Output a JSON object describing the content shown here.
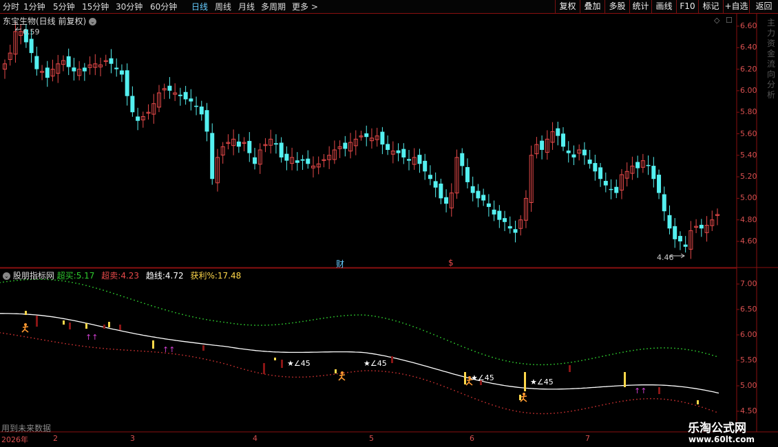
{
  "toolbar": {
    "periods": [
      "分时",
      "1分钟",
      "5分钟",
      "15分钟",
      "30分钟",
      "60分钟",
      "日线",
      "周线",
      "月线",
      "多周期",
      "更多 >"
    ],
    "active_period": "日线",
    "right_buttons": [
      "复权",
      "叠加",
      "多股",
      "统计",
      "画线",
      "F10",
      "标记",
      "+自选",
      "返回"
    ]
  },
  "main_chart": {
    "title": "东宝生物(日线 前复权)",
    "high_label": "6.59",
    "low_label": "4.46",
    "cai_marker": "财",
    "dollar_marker": "$",
    "y_ticks": [
      "6.60",
      "6.40",
      "6.20",
      "6.00",
      "5.80",
      "5.60",
      "5.40",
      "5.20",
      "5.00",
      "4.80",
      "4.60"
    ],
    "side_text": "主力 资金 流向 分析"
  },
  "indicator": {
    "name": "股朋指标网",
    "chaomai_label": "超买:",
    "chaomai_value": "5.17",
    "chaomai2_label": "超卖:",
    "chaomai2_value": "4.23",
    "trend_label": "趋线:",
    "trend_value": "4.72",
    "profit_label": "获利%:",
    "profit_value": "17.48",
    "y_ticks": [
      "7.00",
      "6.50",
      "6.00",
      "5.50",
      "5.00",
      "4.50"
    ],
    "star_labels": [
      "★∠45",
      "★∠45",
      "★∠45",
      "★∠45"
    ],
    "arrow_glyph": "↑↑",
    "footer_note": "用到未来数据"
  },
  "date_axis": {
    "labels": [
      "2026年",
      "2",
      "3",
      "4",
      "5",
      "6",
      "7"
    ]
  },
  "watermark": {
    "name": "乐淘公式网",
    "url": "www.60lt.com"
  },
  "colors": {
    "up": "#e84a4a",
    "down": "#54f0f0",
    "grid": "#8a1010",
    "trend_line": "#ffffff",
    "overbought": "#2ecc2e",
    "oversold": "#c83030"
  }
}
